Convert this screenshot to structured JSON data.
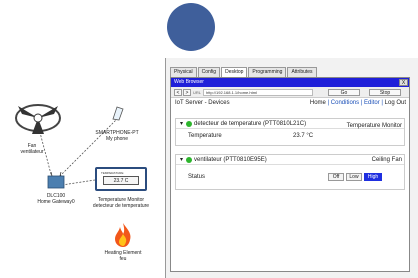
{
  "canvas": {
    "fan": {
      "line1": "Fan",
      "line2": "ventilateur"
    },
    "smartphone": {
      "line1": "SMARTPHONE-PT",
      "line2": "My phone"
    },
    "gateway": {
      "line1": "DLC100",
      "line2": "Home Gateway0"
    },
    "monitor": {
      "screen_title": "TEMPERATURE",
      "screen_value": "23.7 C",
      "line1": "Temperature Monitor",
      "line2": "detecteur de temperature"
    },
    "heater": {
      "line1": "Heating Element",
      "line2": "feu"
    }
  },
  "tabs": [
    "Physical",
    "Config",
    "Desktop",
    "Programming",
    "Attributes"
  ],
  "active_tab": "Desktop",
  "browser": {
    "title": "Web Browser",
    "close": "X",
    "back": "<",
    "forward": ">",
    "url_label": "URL",
    "url": "http://192.168.1.1/home.html",
    "go": "Go",
    "stop": "Stop"
  },
  "menu": {
    "left": "IoT Server - Devices",
    "home": "Home",
    "sep1": "|",
    "conditions": "Conditions",
    "sep2": "|",
    "editor": "Editor",
    "sep3": "|",
    "logout": "Log Out"
  },
  "devices": [
    {
      "title": "detecteur de temperature (PTT0810L21C)",
      "type": "Temperature Monitor",
      "row_label": "Temperature",
      "row_value": "23.7 °C"
    },
    {
      "title": "ventilateur (PTT0810E95E)",
      "type": "Ceiling Fan",
      "row_label": "Status",
      "buttons": [
        "Off",
        "Low",
        "High"
      ],
      "selected": "High"
    }
  ],
  "colors": {
    "titlebar": "#1f1fd9",
    "status_dot": "#2db52d",
    "selected_button": "#1f2fe0",
    "circle": "#3f5f9b"
  }
}
